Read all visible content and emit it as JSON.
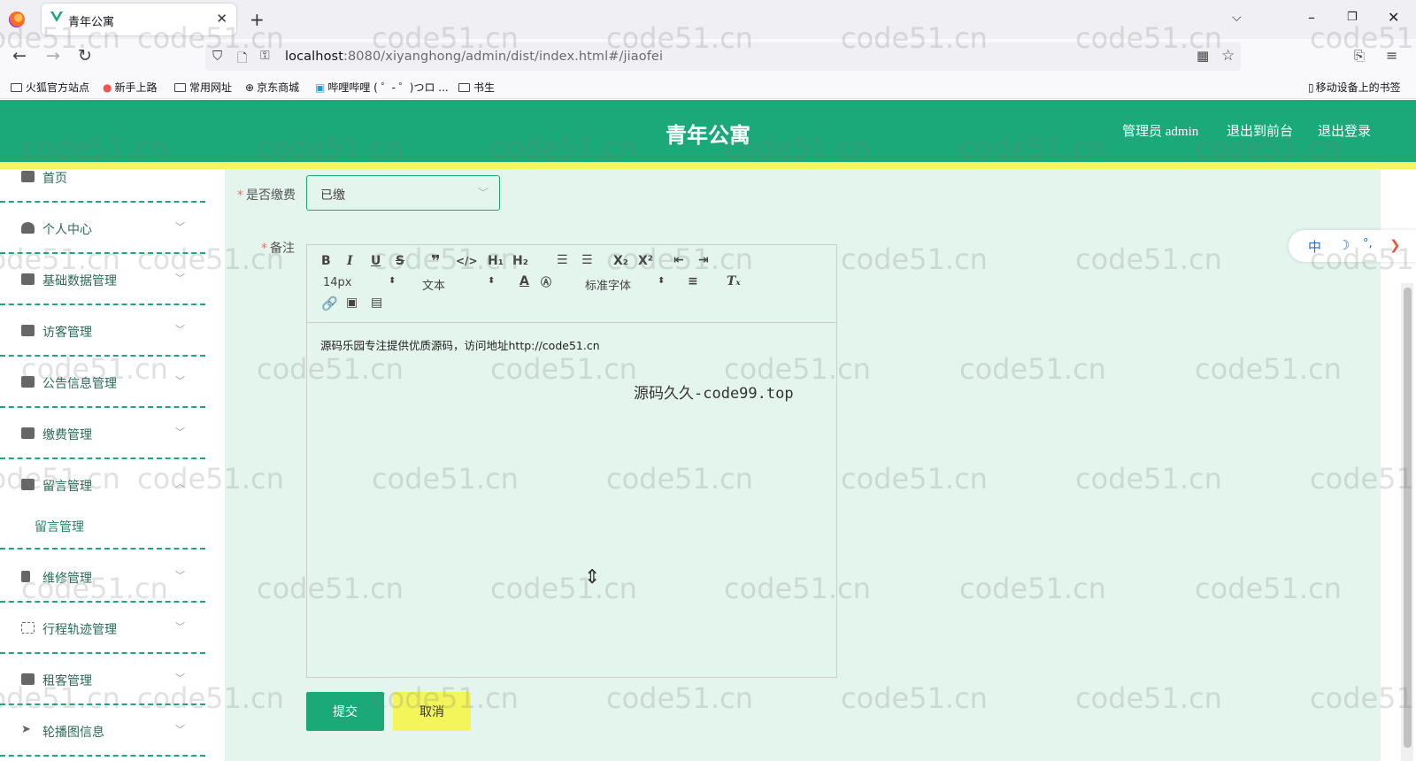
{
  "browser": {
    "tab_title": "青年公寓",
    "url_host": "localhost",
    "url_rest": ":8080/xiyanghong/admin/dist/index.html#/jiaofei",
    "bookmarks": [
      "火狐官方站点",
      "新手上路",
      "常用网址",
      "京东商城",
      "哔哩哔哩 ( ゜- ゜)つロ ...",
      "书生"
    ],
    "mobile_bookmarks": "移动设备上的书签"
  },
  "header": {
    "title": "青年公寓",
    "admin_label": "管理员 admin",
    "to_front": "退出到前台",
    "logout": "退出登录"
  },
  "sidebar": {
    "items": [
      {
        "label": "首页"
      },
      {
        "label": "个人中心"
      },
      {
        "label": "基础数据管理"
      },
      {
        "label": "访客管理"
      },
      {
        "label": "公告信息管理"
      },
      {
        "label": "缴费管理"
      },
      {
        "label": "留言管理"
      },
      {
        "label": "维修管理"
      },
      {
        "label": "行程轨迹管理"
      },
      {
        "label": "租客管理"
      },
      {
        "label": "轮播图信息"
      }
    ],
    "sub_item": "留言管理"
  },
  "form": {
    "paid_label": "是否缴费",
    "paid_value": "已缴",
    "remark_label": "备注",
    "editor": {
      "font_size": "14px",
      "text_style": "文本",
      "font_family": "标准字体",
      "content": "源码乐园专注提供优质源码，访问地址http://code51.cn"
    },
    "submit": "提交",
    "cancel": "取消"
  },
  "ime": {
    "lang": "中",
    "moon": "☽",
    "punct": "°,"
  },
  "watermark": "code51.cn",
  "watermark2": "源码久久-code99.top",
  "colors": {
    "primary": "#1ba97a",
    "accent_yellow": "#f4f55a",
    "content_bg": "#e4f5ee"
  }
}
